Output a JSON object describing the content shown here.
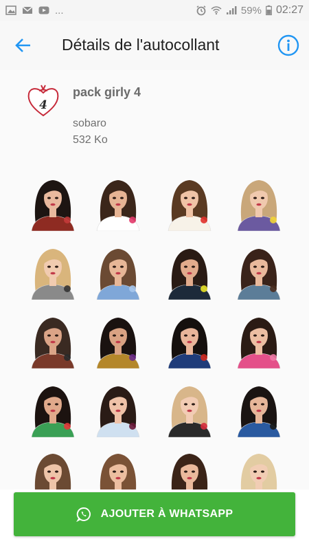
{
  "status_bar": {
    "left_icons": [
      "image-icon",
      "mail-icon",
      "youtube-icon"
    ],
    "overflow": "...",
    "right_icons": [
      "alarm-icon",
      "wifi-icon",
      "signal-icon"
    ],
    "battery": "59%",
    "time": "02:27"
  },
  "app_bar": {
    "title": "Détails de l'autocollant",
    "back_icon": "arrow-back-icon",
    "info_icon": "info-icon"
  },
  "pack": {
    "name": "pack girly 4",
    "publisher": "sobaro",
    "size": "532 Ko",
    "tray_label": "4"
  },
  "stickers": [
    {
      "hair": "#1d1512",
      "skin": "#e9b99e",
      "top": "#8e2b22",
      "accent": "#c43a3a"
    },
    {
      "hair": "#3b261a",
      "skin": "#e6b494",
      "top": "#ffffff",
      "accent": "#e23a6a"
    },
    {
      "hair": "#5a3a22",
      "skin": "#efc3a6",
      "top": "#f7f2e8",
      "accent": "#e0312b"
    },
    {
      "hair": "#c9a77a",
      "skin": "#f0c9ae",
      "top": "#6b5aa0",
      "accent": "#f2d436"
    },
    {
      "hair": "#d9b57c",
      "skin": "#f1cbb0",
      "top": "#8a8a8a",
      "accent": "#333333"
    },
    {
      "hair": "#6b4a33",
      "skin": "#e7b797",
      "top": "#7fa7d8",
      "accent": "#a7c8ee"
    },
    {
      "hair": "#2a1b14",
      "skin": "#e2ab8c",
      "top": "#1d2a3a",
      "accent": "#e8e126"
    },
    {
      "hair": "#3a231a",
      "skin": "#e9b99c",
      "top": "#5c7d98",
      "accent": "#4a2e20"
    },
    {
      "hair": "#3a2a22",
      "skin": "#dba487",
      "top": "#7a3a2a",
      "accent": "#2a2a2a"
    },
    {
      "hair": "#1a1210",
      "skin": "#d9a283",
      "top": "#b4872a",
      "accent": "#6b2c8a"
    },
    {
      "hair": "#15100e",
      "skin": "#e8b59a",
      "top": "#1f3c7a",
      "accent": "#d0281e"
    },
    {
      "hair": "#2b1b14",
      "skin": "#ecbea2",
      "top": "#e4508a",
      "accent": "#f07aa6"
    },
    {
      "hair": "#1c1310",
      "skin": "#e0a98b",
      "top": "#3aa055",
      "accent": "#e23a3a"
    },
    {
      "hair": "#2a1b16",
      "skin": "#efc2a8",
      "top": "#cfe0f0",
      "accent": "#6a1a3a"
    },
    {
      "hair": "#d8b68a",
      "skin": "#f2ccb4",
      "top": "#2a2a2a",
      "accent": "#d62c3c"
    },
    {
      "hair": "#1a1412",
      "skin": "#e6b699",
      "top": "#2a5aa0",
      "accent": "#1a1a1a"
    },
    {
      "hair": "#6b4a33",
      "skin": "#eec4a8",
      "top": "#b59ad8",
      "accent": "#f0c0d6"
    },
    {
      "hair": "#7a5236",
      "skin": "#ecbea0",
      "top": "#c23a3a",
      "accent": "#2a2a2a"
    },
    {
      "hair": "#3b2418",
      "skin": "#eab99c",
      "top": "#9a1f2f",
      "accent": "#b02232"
    },
    {
      "hair": "#e2cca2",
      "skin": "#f1cdb4",
      "top": "#d9d9d9",
      "accent": "#c9a77a"
    }
  ],
  "add_button": {
    "label": "AJOUTER À WHATSAPP",
    "icon": "whatsapp-icon"
  },
  "colors": {
    "accent": "#2196f3",
    "button": "#43b33b",
    "tray_heart": "#c62a3a"
  }
}
